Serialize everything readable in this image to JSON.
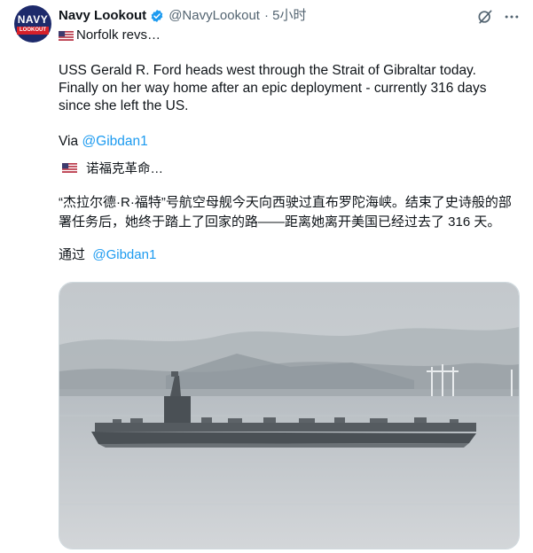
{
  "author": {
    "name": "Navy Lookout",
    "handle": "@NavyLookout",
    "time": "· 5小时",
    "avatar_top": "NAVY",
    "avatar_bottom": "LOOKOUT"
  },
  "reply_line": "Norfolk revs…",
  "tweet": {
    "text": "USS Gerald R. Ford heads west through the Strait of Gibraltar today. Finally on her way home after an epic deployment - currently 316 days since she left the US.",
    "via_prefix": "Via ",
    "via_link": "@Gibdan1"
  },
  "translation": {
    "header": "诺福克革命…",
    "text": "“杰拉尔德·R·福特”号航空母舰今天向西驶过直布罗陀海峡。结束了史诗般的部署任务后，她终于踏上了回家的路——距离她离开美国已经过去了 316 天。",
    "via_prefix": "通过",
    "via_link": "@Gibdan1"
  },
  "icons": {
    "verified": "verified-badge-icon",
    "grok": "grok-icon",
    "more": "more-icon",
    "flag": "us-flag-icon"
  },
  "colors": {
    "link": "#1d9bf0",
    "verified": "#1d9bf0",
    "secondary_text": "#536471",
    "avatar_bg": "#1d2a6b",
    "avatar_accent": "#d6202a"
  }
}
